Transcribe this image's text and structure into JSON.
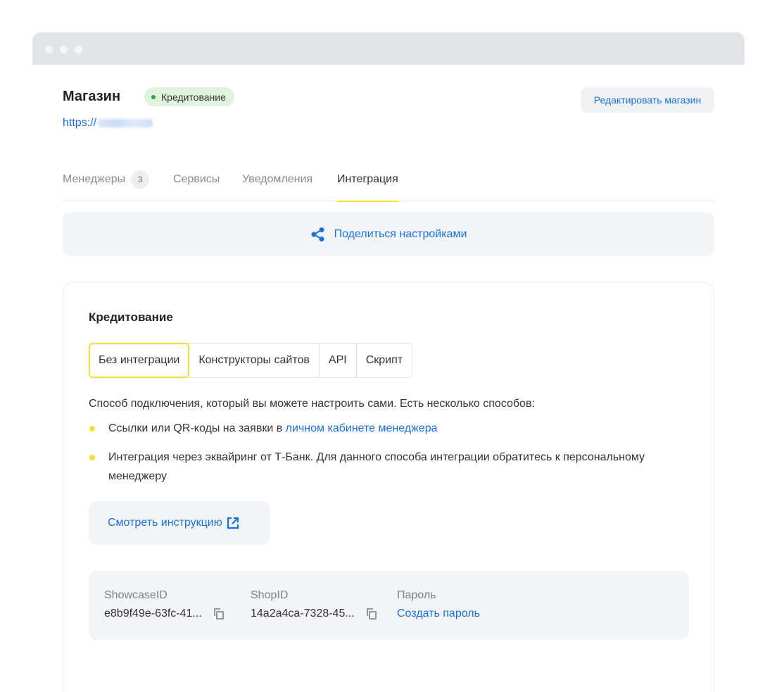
{
  "store": {
    "title": "Магазин",
    "badge": "Кредитование",
    "url_prefix": "https://",
    "edit_label": "Редактировать магазин"
  },
  "tabs": [
    {
      "label": "Менеджеры",
      "count": "3"
    },
    {
      "label": "Сервисы"
    },
    {
      "label": "Уведомления"
    },
    {
      "label": "Интеграция",
      "active": true
    }
  ],
  "share_label": "Поделиться настройками",
  "credit": {
    "title": "Кредитование",
    "segments": [
      "Без интеграции",
      "Конструкторы сайтов",
      "API",
      "Скрипт"
    ],
    "active_segment": "Без интеграции",
    "description": "Способ подключения, который вы можете настроить сами. Есть несколько способов:",
    "bullet1_text": "Ссылки или QR-коды на заявки в ",
    "bullet1_link": "личном кабинете менеджера",
    "bullet2_text": "Интеграция через эквайринг от Т-Банк. Для данного способа интеграции обратитесь к персональному менеджеру",
    "instruction_label": "Смотреть инструкцию"
  },
  "ids": {
    "showcase_label": "ShowcaseID",
    "showcase_value": "e8b9f49e-63fc-41...",
    "shop_label": "ShopID",
    "shop_value": "14a2a4ca-7328-45...",
    "password_label": "Пароль",
    "password_action": "Создать пароль"
  },
  "colors": {
    "accent_blue": "#1771e6",
    "accent_yellow": "#ffdd2d",
    "badge_green": "#23a93f"
  },
  "icons": [
    "share-icon",
    "external-link-icon",
    "copy-icon"
  ]
}
